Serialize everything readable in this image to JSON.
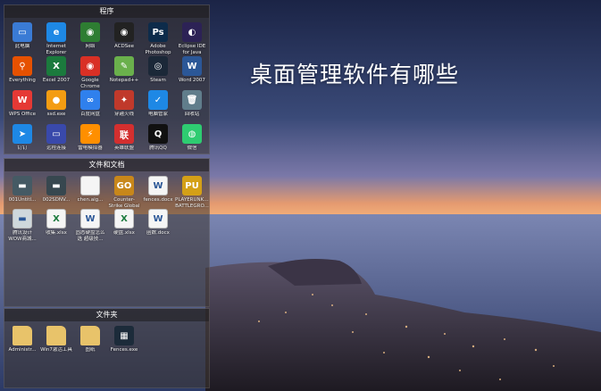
{
  "headline": "桌面管理软件有哪些",
  "fences": {
    "programs": {
      "title": "程序",
      "items": [
        {
          "label": "此电脑",
          "icon": "computer-icon",
          "glyph": "▭",
          "bg": "#3a7bd5"
        },
        {
          "label": "Internet Explorer",
          "icon": "internet-explorer-icon",
          "glyph": "e",
          "bg": "#1e88e5"
        },
        {
          "label": "网络",
          "icon": "network-icon",
          "glyph": "◉",
          "bg": "#2e7d32"
        },
        {
          "label": "ACDSee",
          "icon": "acdsee-icon",
          "glyph": "◉",
          "bg": "#222222"
        },
        {
          "label": "Adobe Photoshop",
          "icon": "photoshop-icon",
          "glyph": "Ps",
          "bg": "#0d2b4a"
        },
        {
          "label": "Eclipse IDE for Java",
          "icon": "eclipse-icon",
          "glyph": "◐",
          "bg": "#2c2255"
        },
        {
          "label": "Everything",
          "icon": "everything-search-icon",
          "glyph": "⚲",
          "bg": "#e65100"
        },
        {
          "label": "Excel 2007",
          "icon": "excel-icon",
          "glyph": "X",
          "bg": "#1b7a3d"
        },
        {
          "label": "Google Chrome",
          "icon": "chrome-icon",
          "glyph": "◉",
          "bg": "#d93025"
        },
        {
          "label": "Notepad++",
          "icon": "notepad-plus-plus-icon",
          "glyph": "✎",
          "bg": "#6ab04c"
        },
        {
          "label": "Steam",
          "icon": "steam-icon",
          "glyph": "◎",
          "bg": "#1b2838"
        },
        {
          "label": "Word 2007",
          "icon": "word-icon",
          "glyph": "W",
          "bg": "#2b5797"
        },
        {
          "label": "WPS Office",
          "icon": "wps-office-icon",
          "glyph": "W",
          "bg": "#e53935"
        },
        {
          "label": "ssd.exe",
          "icon": "ssd-app-icon",
          "glyph": "●",
          "bg": "#f39c12"
        },
        {
          "label": "百度网盘",
          "icon": "baidu-netdisk-icon",
          "glyph": "∞",
          "bg": "#2f80ed"
        },
        {
          "label": "穿越火线",
          "icon": "crossfire-icon",
          "glyph": "✦",
          "bg": "#c0392b"
        },
        {
          "label": "电脑管家",
          "icon": "pc-manager-icon",
          "glyph": "✓",
          "bg": "#1e88e5"
        },
        {
          "label": "回收站",
          "icon": "recycle-bin-icon",
          "glyph": "🗑",
          "bg": "#607d8b"
        },
        {
          "label": "钉钉",
          "icon": "dingtalk-icon",
          "glyph": "➤",
          "bg": "#1e88e5"
        },
        {
          "label": "远程连接",
          "icon": "remote-desktop-icon",
          "glyph": "▭",
          "bg": "#3949ab"
        },
        {
          "label": "雷电模拟器",
          "icon": "ldplayer-icon",
          "glyph": "⚡",
          "bg": "#ff8f00"
        },
        {
          "label": "英雄联盟",
          "icon": "lol-icon",
          "glyph": "联",
          "bg": "#d32f2f"
        },
        {
          "label": "腾讯QQ",
          "icon": "qq-penguin-icon",
          "glyph": "Q",
          "bg": "#111111"
        },
        {
          "label": "微信",
          "icon": "wechat-icon",
          "glyph": "◍",
          "bg": "#2ecc71"
        }
      ]
    },
    "documents": {
      "title": "文件和文档",
      "items": [
        {
          "label": "001Untitl...",
          "icon": "document-thumbnail-icon",
          "glyph": "▬",
          "bg": "#455a64"
        },
        {
          "label": "002SDNV...",
          "icon": "document-thumbnail-icon",
          "glyph": "▬",
          "bg": "#37474f"
        },
        {
          "label": "chen.aig...",
          "icon": "file-icon",
          "glyph": "",
          "bg": "#f5f5f5"
        },
        {
          "label": "Counter-Strike Global Offe...",
          "icon": "csgo-icon",
          "glyph": "GO",
          "bg": "#c8871a"
        },
        {
          "label": "fences.docx",
          "icon": "word-doc-icon",
          "glyph": "W",
          "bg": "#f5f5f5"
        },
        {
          "label": "PLAYERUNKNOWN BATTLEGRO...",
          "icon": "pubg-icon",
          "glyph": "PU",
          "bg": "#d4a017"
        },
        {
          "label": "腾讯设计 WOW商城...",
          "icon": "image-thumbnail-icon",
          "glyph": "▬",
          "bg": "#cfd8dc"
        },
        {
          "label": "收集.xlsx",
          "icon": "excel-doc-icon",
          "glyph": "X",
          "bg": "#f5f5f5"
        },
        {
          "label": "固态硬盘怎么选 超级技...",
          "icon": "word-doc-icon",
          "glyph": "W",
          "bg": "#f5f5f5"
        },
        {
          "label": "硬盘.xlsx",
          "icon": "excel-doc-icon",
          "glyph": "X",
          "bg": "#f5f5f5"
        },
        {
          "label": "函数.docx",
          "icon": "word-doc-icon",
          "glyph": "W",
          "bg": "#f5f5f5"
        }
      ]
    },
    "folders": {
      "title": "文件夹",
      "items": [
        {
          "label": "Administr...",
          "icon": "user-folder-icon",
          "glyph": "",
          "bg": "#e8c36a"
        },
        {
          "label": "Win7激活工具",
          "icon": "folder-icon",
          "glyph": "",
          "bg": "#e8c36a"
        },
        {
          "label": "图纸",
          "icon": "folder-icon",
          "glyph": "",
          "bg": "#e8c36a"
        },
        {
          "label": "Fences.exe",
          "icon": "fences-app-icon",
          "glyph": "▦",
          "bg": "#1c2b3a"
        }
      ]
    }
  }
}
